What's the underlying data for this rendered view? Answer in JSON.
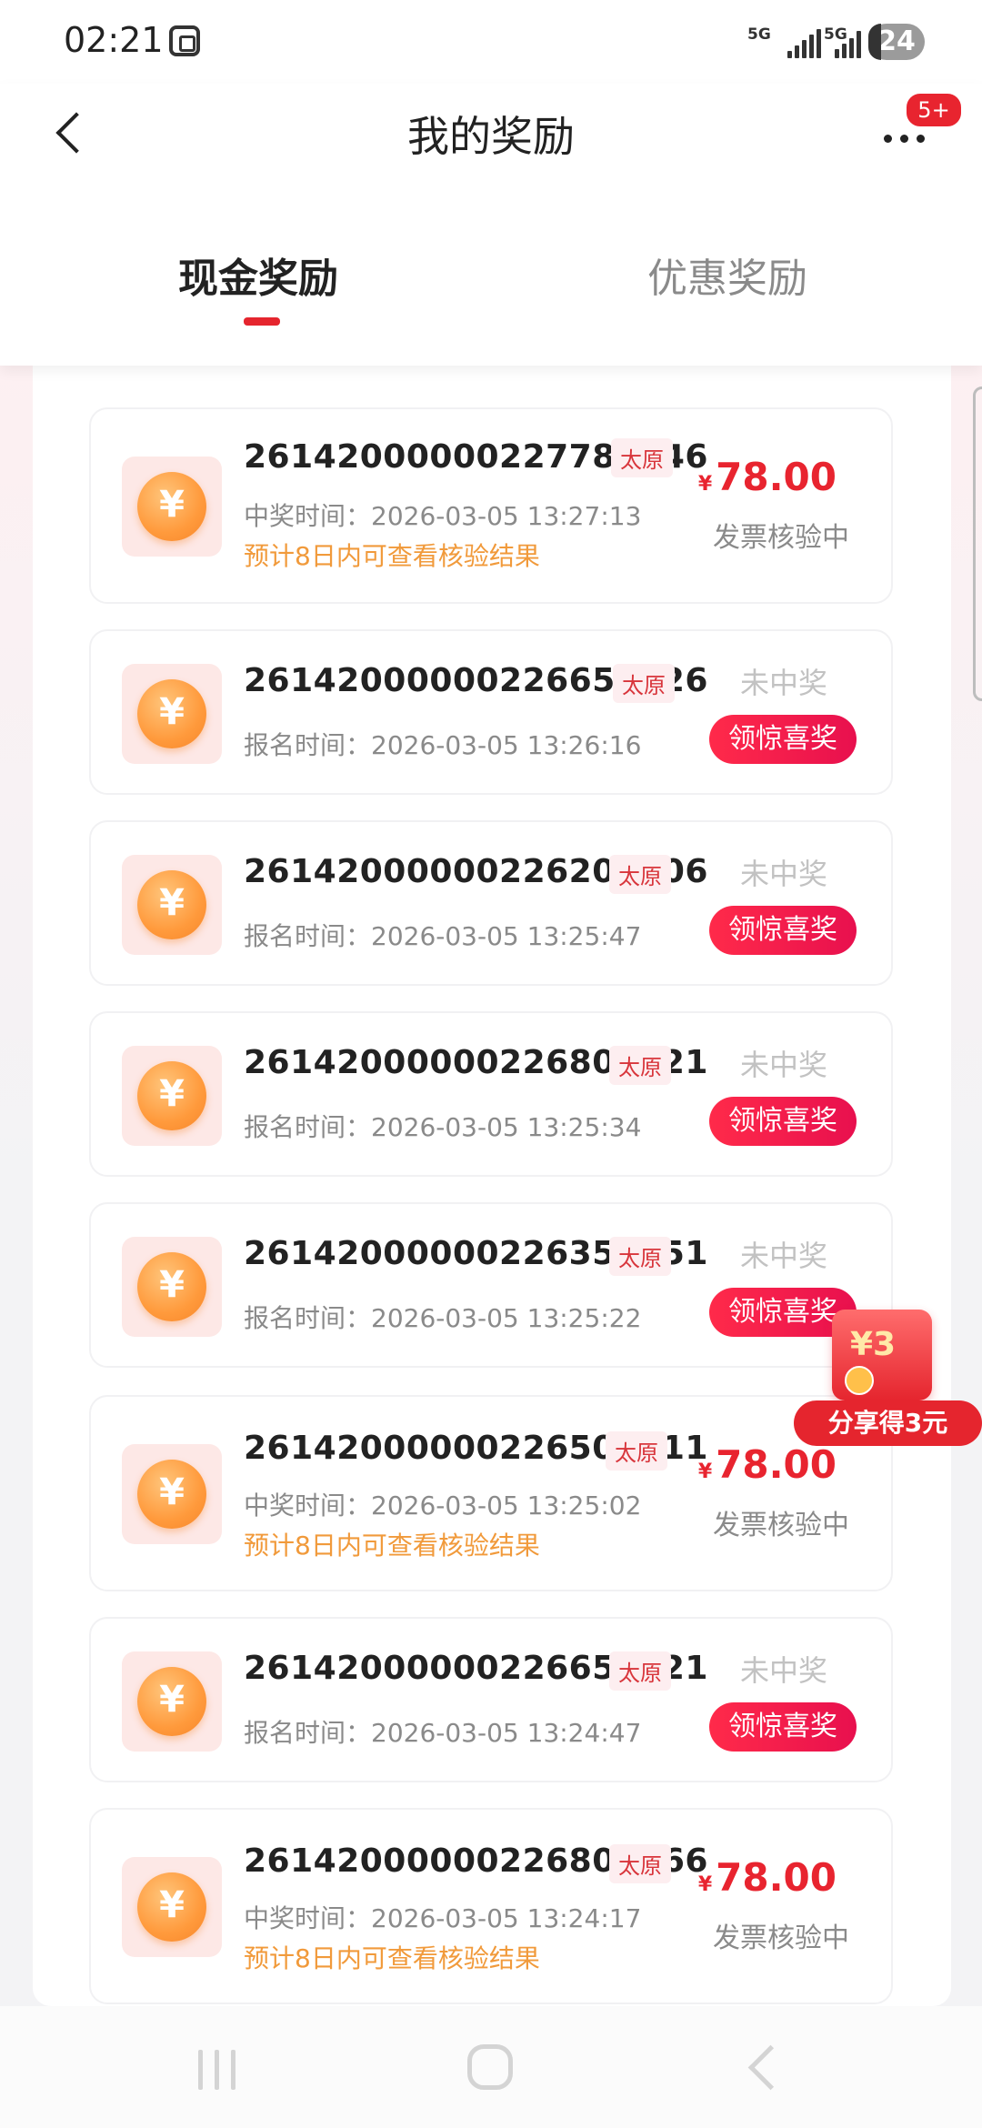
{
  "status_bar": {
    "time": "02:21",
    "net1": "5G",
    "net2": "5G",
    "battery": "24"
  },
  "header": {
    "title": "我的奖励",
    "more_badge": "5+"
  },
  "tabs": {
    "cash": "现金奖励",
    "coupon": "优惠奖励"
  },
  "records": [
    {
      "number": "26142000000227782546",
      "city": "太原",
      "time_label": "中奖时间：2026-03-05 13:27:13",
      "note": "预计8日内可查看核验结果",
      "amount_symbol": "¥",
      "amount": "78.00",
      "status": "发票核验中"
    },
    {
      "number": "26142000000226655626",
      "city": "太原",
      "time_label": "报名时间：2026-03-05 13:26:16",
      "result": "未中奖",
      "action": "领惊喜奖"
    },
    {
      "number": "26142000000226206106",
      "city": "太原",
      "time_label": "报名时间：2026-03-05 13:25:47",
      "result": "未中奖",
      "action": "领惊喜奖"
    },
    {
      "number": "26142000000226805221",
      "city": "太原",
      "time_label": "报名时间：2026-03-05 13:25:34",
      "result": "未中奖",
      "action": "领惊喜奖"
    },
    {
      "number": "26142000000226357051",
      "city": "太原",
      "time_label": "报名时间：2026-03-05 13:25:22",
      "result": "未中奖",
      "action": "领惊喜奖"
    },
    {
      "number": "26142000000226505311",
      "city": "太原",
      "time_label": "中奖时间：2026-03-05 13:25:02",
      "note": "预计8日内可查看核验结果",
      "amount_symbol": "¥",
      "amount": "78.00",
      "status": "发票核验中"
    },
    {
      "number": "26142000000226653721",
      "city": "太原",
      "time_label": "报名时间：2026-03-05 13:24:47",
      "result": "未中奖",
      "action": "领惊喜奖"
    },
    {
      "number": "26142000000226801666",
      "city": "太原",
      "time_label": "中奖时间：2026-03-05 13:24:17",
      "note": "预计8日内可查看核验结果",
      "amount_symbol": "¥",
      "amount": "78.00",
      "status": "发票核验中"
    }
  ],
  "share": {
    "envelope_value": "¥3",
    "label": "分享得3元"
  },
  "icons": {
    "coin": "coin-yuan-icon",
    "back": "chevron-left-icon",
    "more": "more-dots-icon"
  },
  "colors": {
    "accent": "#e8242f",
    "note": "#f19a3b"
  }
}
